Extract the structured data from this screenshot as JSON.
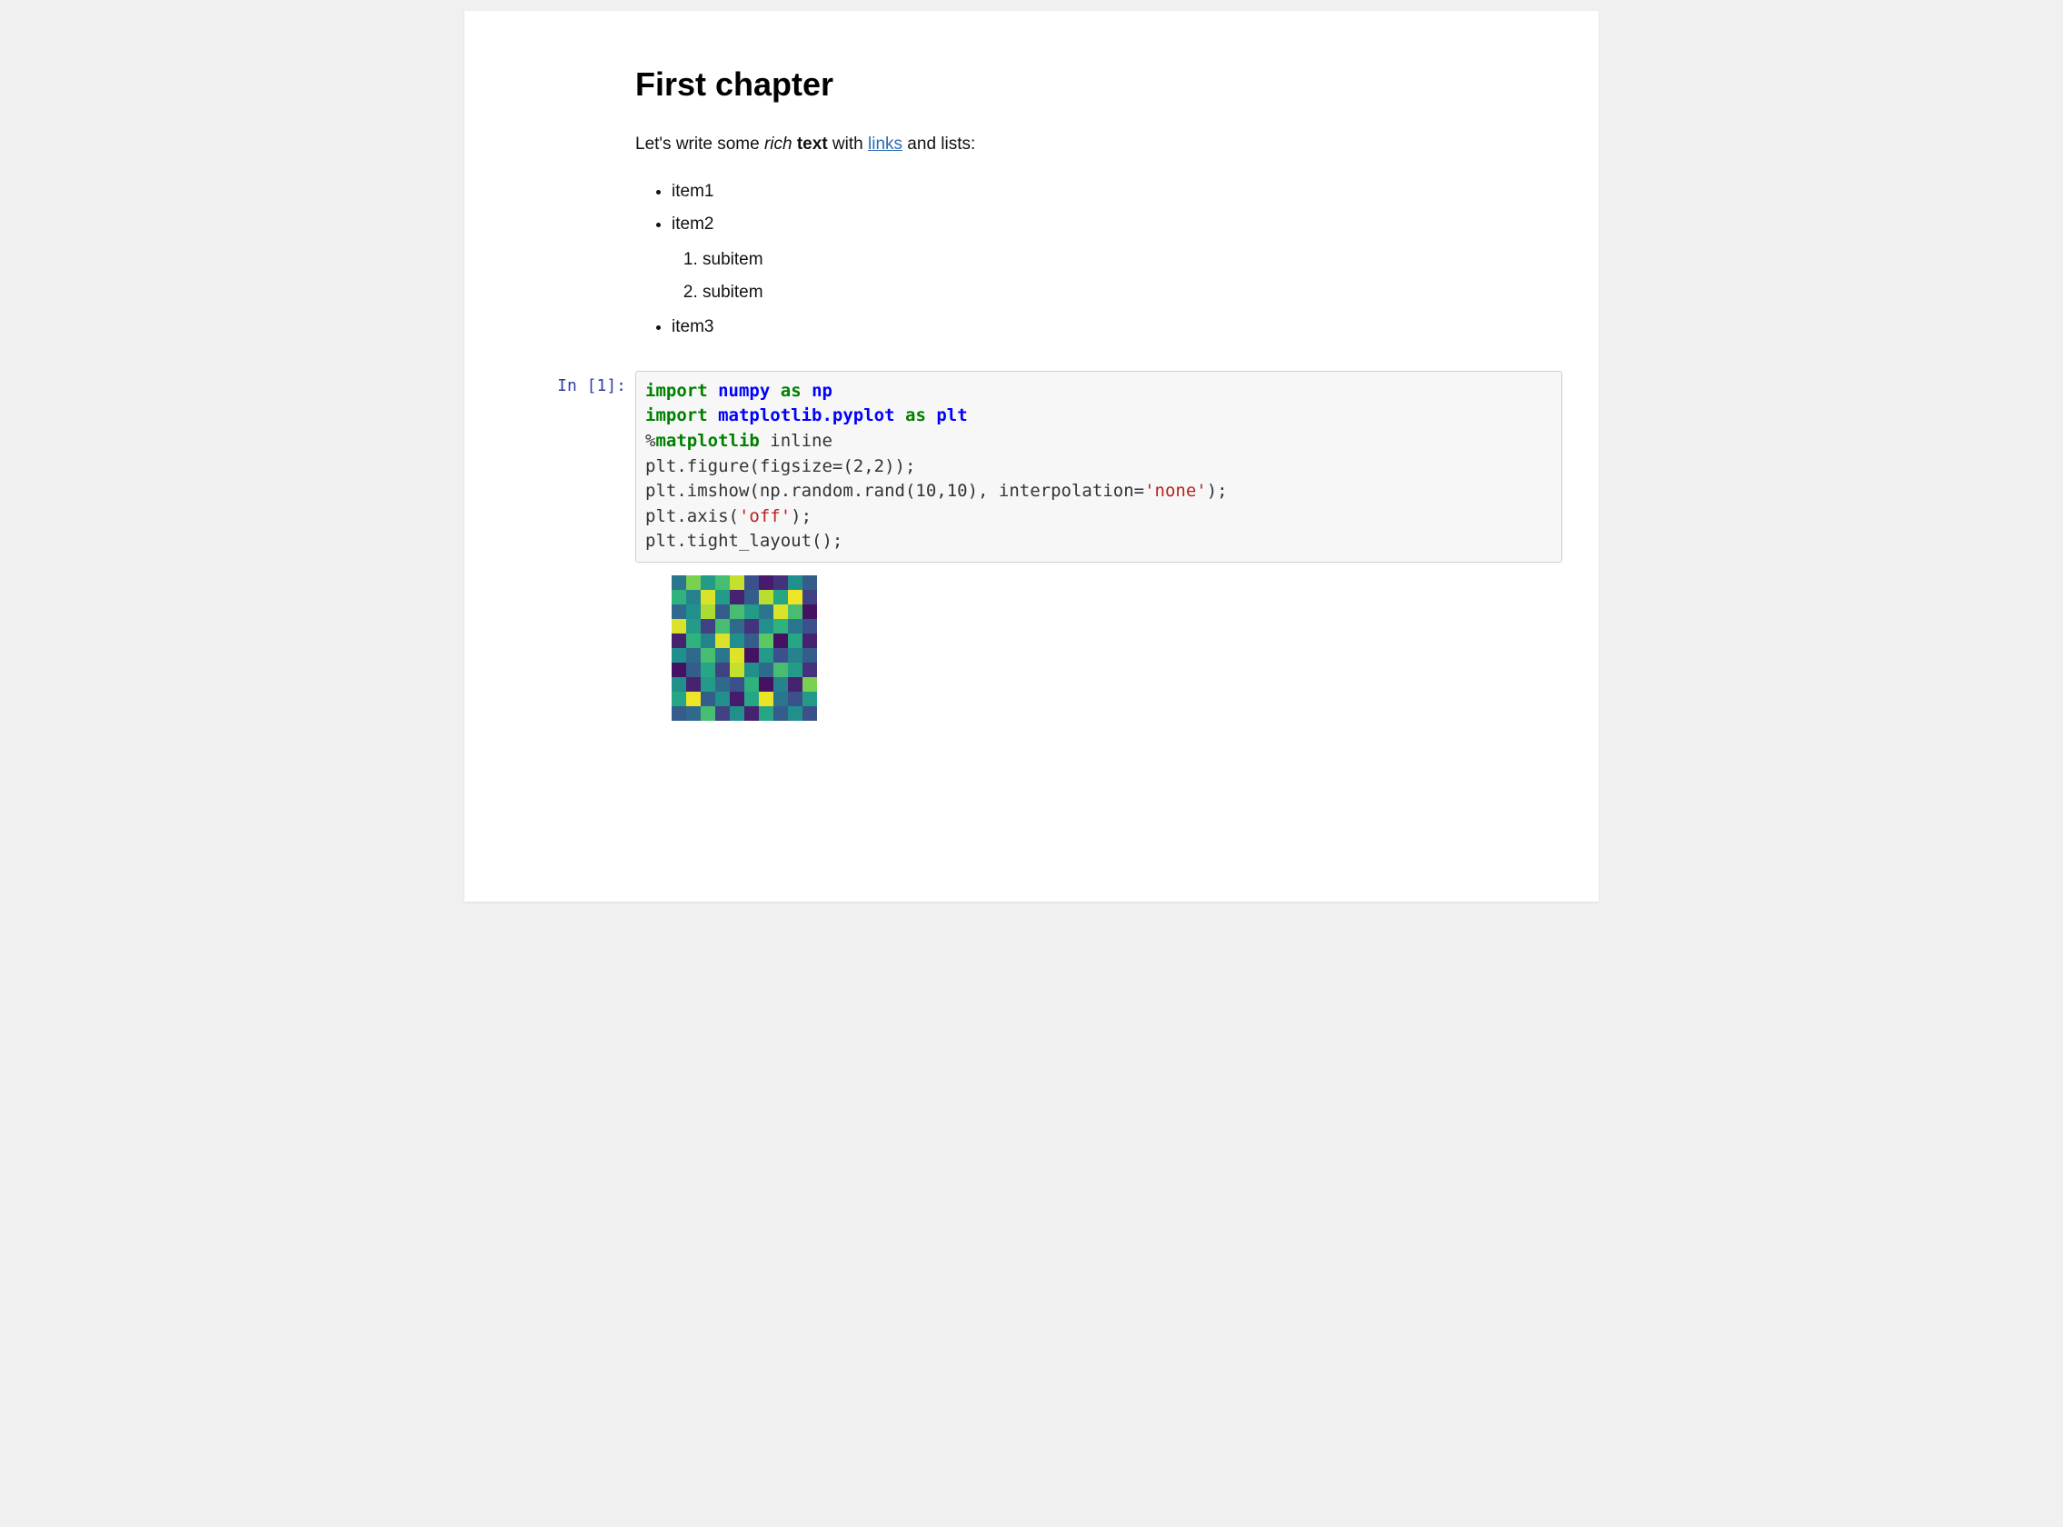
{
  "heading": "First chapter",
  "intro": {
    "pre": "Let's write some ",
    "italic": "rich",
    "space": " ",
    "bold": "text",
    "mid": " with ",
    "link": "links",
    "post": " and lists:"
  },
  "list": {
    "item1": "item1",
    "item2": "item2",
    "sub1": "subitem",
    "sub2": "subitem",
    "item3": "item3"
  },
  "cell": {
    "prompt": "In [1]:",
    "code": {
      "l1_import": "import",
      "l1_mod": "numpy",
      "l1_as": "as",
      "l1_alias": "np",
      "l2_import": "import",
      "l2_mod": "matplotlib.pyplot",
      "l2_as": "as",
      "l2_alias": "plt",
      "l3_magic": "matplotlib",
      "l3_rest": " inline",
      "l4": "plt.figure(figsize=(2,2));",
      "l5a": "plt.imshow(np.random.rand(10,10), interpolation=",
      "l5str": "'none'",
      "l5b": ");",
      "l6a": "plt.axis(",
      "l6str": "'off'",
      "l6b": ");",
      "l7": "plt.tight_layout();"
    }
  },
  "chart_data": {
    "type": "heatmap",
    "title": "",
    "shape": [
      10,
      10
    ],
    "colormap": "viridis",
    "axes": "off",
    "interpolation": "none",
    "values": [
      [
        0.4,
        0.8,
        0.55,
        0.7,
        0.92,
        0.25,
        0.08,
        0.15,
        0.5,
        0.3
      ],
      [
        0.65,
        0.45,
        0.95,
        0.55,
        0.1,
        0.3,
        0.9,
        0.6,
        0.98,
        0.2
      ],
      [
        0.35,
        0.5,
        0.88,
        0.3,
        0.7,
        0.55,
        0.4,
        0.95,
        0.7,
        0.05
      ],
      [
        0.95,
        0.55,
        0.2,
        0.7,
        0.35,
        0.15,
        0.5,
        0.65,
        0.4,
        0.25
      ],
      [
        0.1,
        0.65,
        0.45,
        0.95,
        0.5,
        0.3,
        0.75,
        0.05,
        0.6,
        0.1
      ],
      [
        0.5,
        0.35,
        0.7,
        0.4,
        0.96,
        0.05,
        0.55,
        0.25,
        0.45,
        0.3
      ],
      [
        0.05,
        0.3,
        0.6,
        0.2,
        0.92,
        0.5,
        0.35,
        0.7,
        0.55,
        0.15
      ],
      [
        0.5,
        0.1,
        0.55,
        0.35,
        0.25,
        0.65,
        0.05,
        0.45,
        0.1,
        0.8
      ],
      [
        0.6,
        0.98,
        0.3,
        0.5,
        0.08,
        0.6,
        0.97,
        0.4,
        0.25,
        0.55
      ],
      [
        0.3,
        0.35,
        0.7,
        0.2,
        0.5,
        0.1,
        0.6,
        0.3,
        0.5,
        0.25
      ]
    ]
  }
}
